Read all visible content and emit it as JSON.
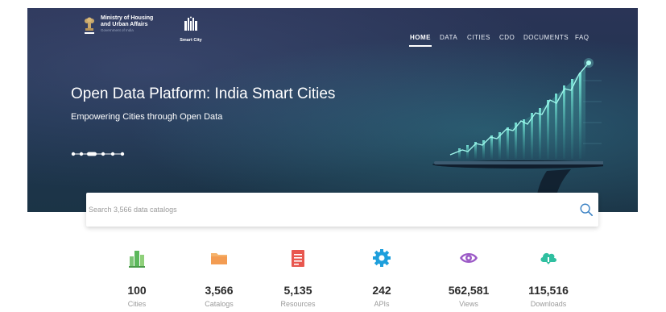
{
  "header": {
    "ministry_line1": "Ministry of Housing",
    "ministry_line2": "and Urban Affairs",
    "ministry_sub": "Government of India",
    "smart_city_label": "Smart City"
  },
  "nav": {
    "items": [
      {
        "label": "HOME",
        "active": true
      },
      {
        "label": "DATA"
      },
      {
        "label": "CITIES"
      },
      {
        "label": "CDO"
      },
      {
        "label": "DOCUMENTS"
      },
      {
        "label": "FAQ"
      }
    ]
  },
  "hero": {
    "title": "Open Data Platform: India Smart Cities",
    "subtitle": "Empowering Cities through Open Data",
    "carousel_dots": 6,
    "carousel_active_index": 2
  },
  "search": {
    "placeholder": "Search 3,566 data catalogs",
    "value": ""
  },
  "stats": [
    {
      "value": "100",
      "label": "Cities",
      "icon": "city-buildings-icon",
      "color": "#5cb85c"
    },
    {
      "value": "3,566",
      "label": "Catalogs",
      "icon": "folder-icon",
      "color": "#f39c52"
    },
    {
      "value": "5,135",
      "label": "Resources",
      "icon": "document-icon",
      "color": "#e8574f"
    },
    {
      "value": "242",
      "label": "APIs",
      "icon": "gear-icon",
      "color": "#1e9fdc"
    },
    {
      "value": "562,581",
      "label": "Views",
      "icon": "eye-icon",
      "color": "#9b59c6"
    },
    {
      "value": "115,516",
      "label": "Downloads",
      "icon": "cloud-download-icon",
      "color": "#2fbfa0"
    }
  ],
  "colors": {
    "hero_bg": "#243452",
    "accent": "#3b82c4"
  }
}
